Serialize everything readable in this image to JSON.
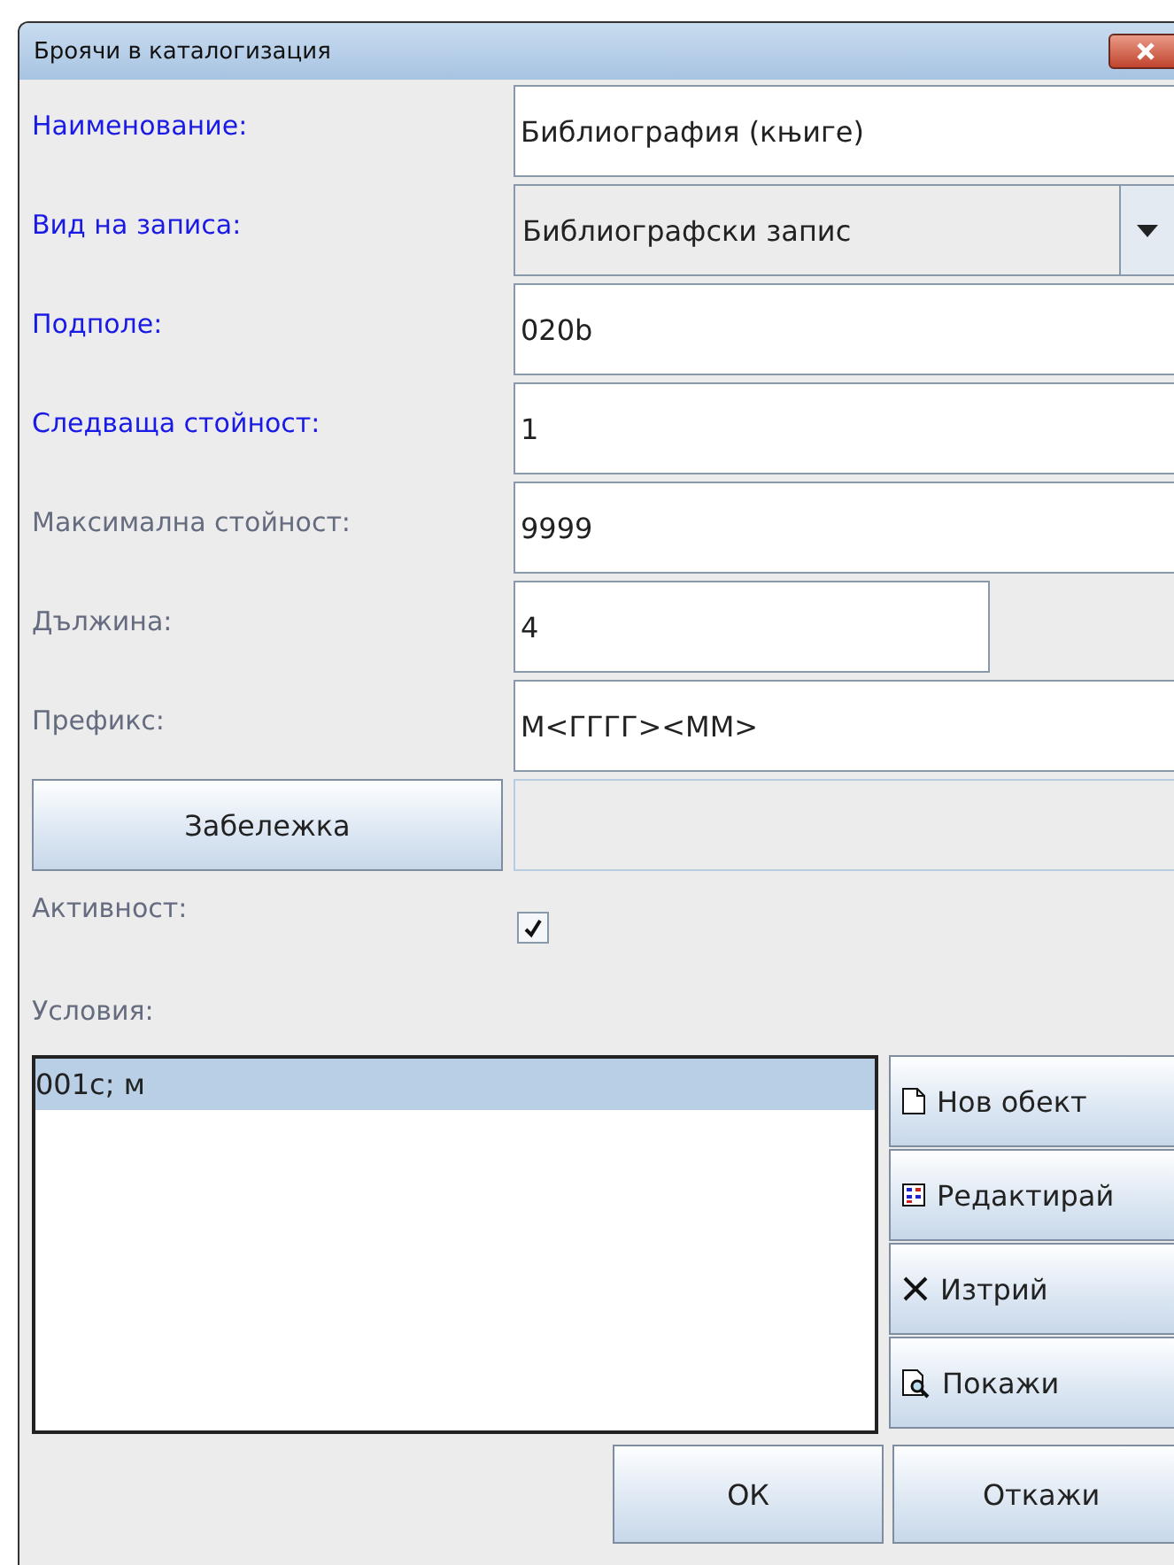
{
  "window": {
    "title": "Броячи в каталогизация"
  },
  "fields": [
    {
      "label": "Наименование:",
      "required": true,
      "kind": "text",
      "value": "Библиография (књиге)"
    },
    {
      "label": "Вид на записа:",
      "required": true,
      "kind": "combo",
      "value": "Библиографски запис"
    },
    {
      "label": "Подполе:",
      "required": true,
      "kind": "text",
      "value": "020b"
    },
    {
      "label": "Следваща стойност:",
      "required": true,
      "kind": "text",
      "value": "1"
    },
    {
      "label": "Максимална стойност:",
      "required": false,
      "kind": "text",
      "value": "9999"
    },
    {
      "label": "Дължина:",
      "required": false,
      "kind": "short",
      "value": "4"
    },
    {
      "label": "Префикс:",
      "required": false,
      "kind": "text",
      "value": "М<ГГГГ><ММ>"
    }
  ],
  "note_button": "Забележка",
  "active": {
    "label": "Активност:",
    "checked": true
  },
  "conditions": {
    "label": "Условия:",
    "items": [
      {
        "text": "001c; м",
        "selected": true
      }
    ]
  },
  "side_buttons": [
    {
      "label": "Нов обект",
      "kind": "new"
    },
    {
      "label": "Редактирай",
      "kind": "edit"
    },
    {
      "label": "Изтрий",
      "kind": "delete"
    },
    {
      "label": "Покажи",
      "kind": "view"
    }
  ],
  "buttons": [
    "ОК",
    "Откажи"
  ]
}
